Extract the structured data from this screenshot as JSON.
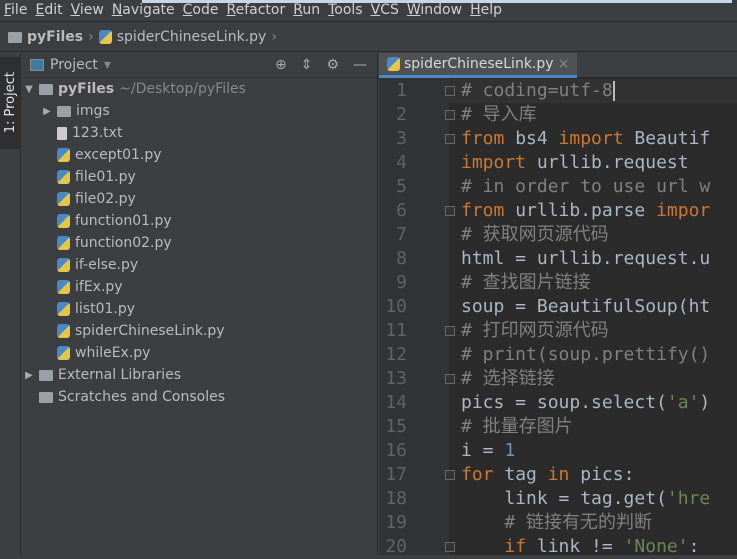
{
  "menu": [
    "File",
    "Edit",
    "View",
    "Navigate",
    "Code",
    "Refactor",
    "Run",
    "Tools",
    "VCS",
    "Window",
    "Help"
  ],
  "breadcrumb": {
    "project": "pyFiles",
    "file": "spiderChineseLink.py"
  },
  "side_tab": "1: Project",
  "project_panel": {
    "title": "Project",
    "root": {
      "name": "pyFiles",
      "path": "~/Desktop/pyFiles"
    },
    "items": [
      "imgs",
      "123.txt",
      "except01.py",
      "file01.py",
      "file02.py",
      "function01.py",
      "function02.py",
      "if-else.py",
      "ifEx.py",
      "list01.py",
      "spiderChineseLink.py",
      "whileEx.py"
    ],
    "external": "External Libraries",
    "scratches": "Scratches and Consoles"
  },
  "editor": {
    "tab": "spiderChineseLink.py",
    "lines": [
      [
        [
          "cm",
          "# coding=utf-8"
        ]
      ],
      [
        [
          "cm",
          "# 导入库"
        ]
      ],
      [
        [
          "kw",
          "from "
        ],
        [
          "",
          "bs4 "
        ],
        [
          "kw",
          "import "
        ],
        [
          "",
          "Beautif"
        ]
      ],
      [
        [
          "kw",
          "import "
        ],
        [
          "",
          "urllib.request"
        ]
      ],
      [
        [
          "cm",
          "# in order to use url w"
        ]
      ],
      [
        [
          "kw",
          "from "
        ],
        [
          "",
          "urllib.parse "
        ],
        [
          "kw",
          "impor"
        ]
      ],
      [
        [
          "cm",
          "# 获取网页源代码"
        ]
      ],
      [
        [
          "",
          "html = urllib.request.u"
        ]
      ],
      [
        [
          "cm",
          "# 查找图片链接"
        ]
      ],
      [
        [
          "",
          "soup = BeautifulSoup(ht"
        ]
      ],
      [
        [
          "cm",
          "# 打印网页源代码"
        ]
      ],
      [
        [
          "cm",
          "# print(soup.prettify()"
        ]
      ],
      [
        [
          "cm",
          "# 选择链接"
        ]
      ],
      [
        [
          "",
          "pics = soup.select("
        ],
        [
          "st",
          "'a'"
        ],
        [
          "",
          ")"
        ]
      ],
      [
        [
          "cm",
          "# 批量存图片"
        ]
      ],
      [
        [
          "",
          "i = "
        ],
        [
          "nu",
          "1"
        ]
      ],
      [
        [
          "kw",
          "for "
        ],
        [
          "",
          "tag "
        ],
        [
          "kw",
          "in "
        ],
        [
          "",
          "pics:"
        ]
      ],
      [
        [
          "",
          "    link = tag.get("
        ],
        [
          "st",
          "'hre"
        ]
      ],
      [
        [
          "cm",
          "    # 链接有无的判断"
        ]
      ],
      [
        [
          "",
          "    "
        ],
        [
          "kw",
          "if "
        ],
        [
          "",
          "link != "
        ],
        [
          "st",
          "'None'"
        ],
        [
          "",
          ":"
        ]
      ]
    ]
  }
}
